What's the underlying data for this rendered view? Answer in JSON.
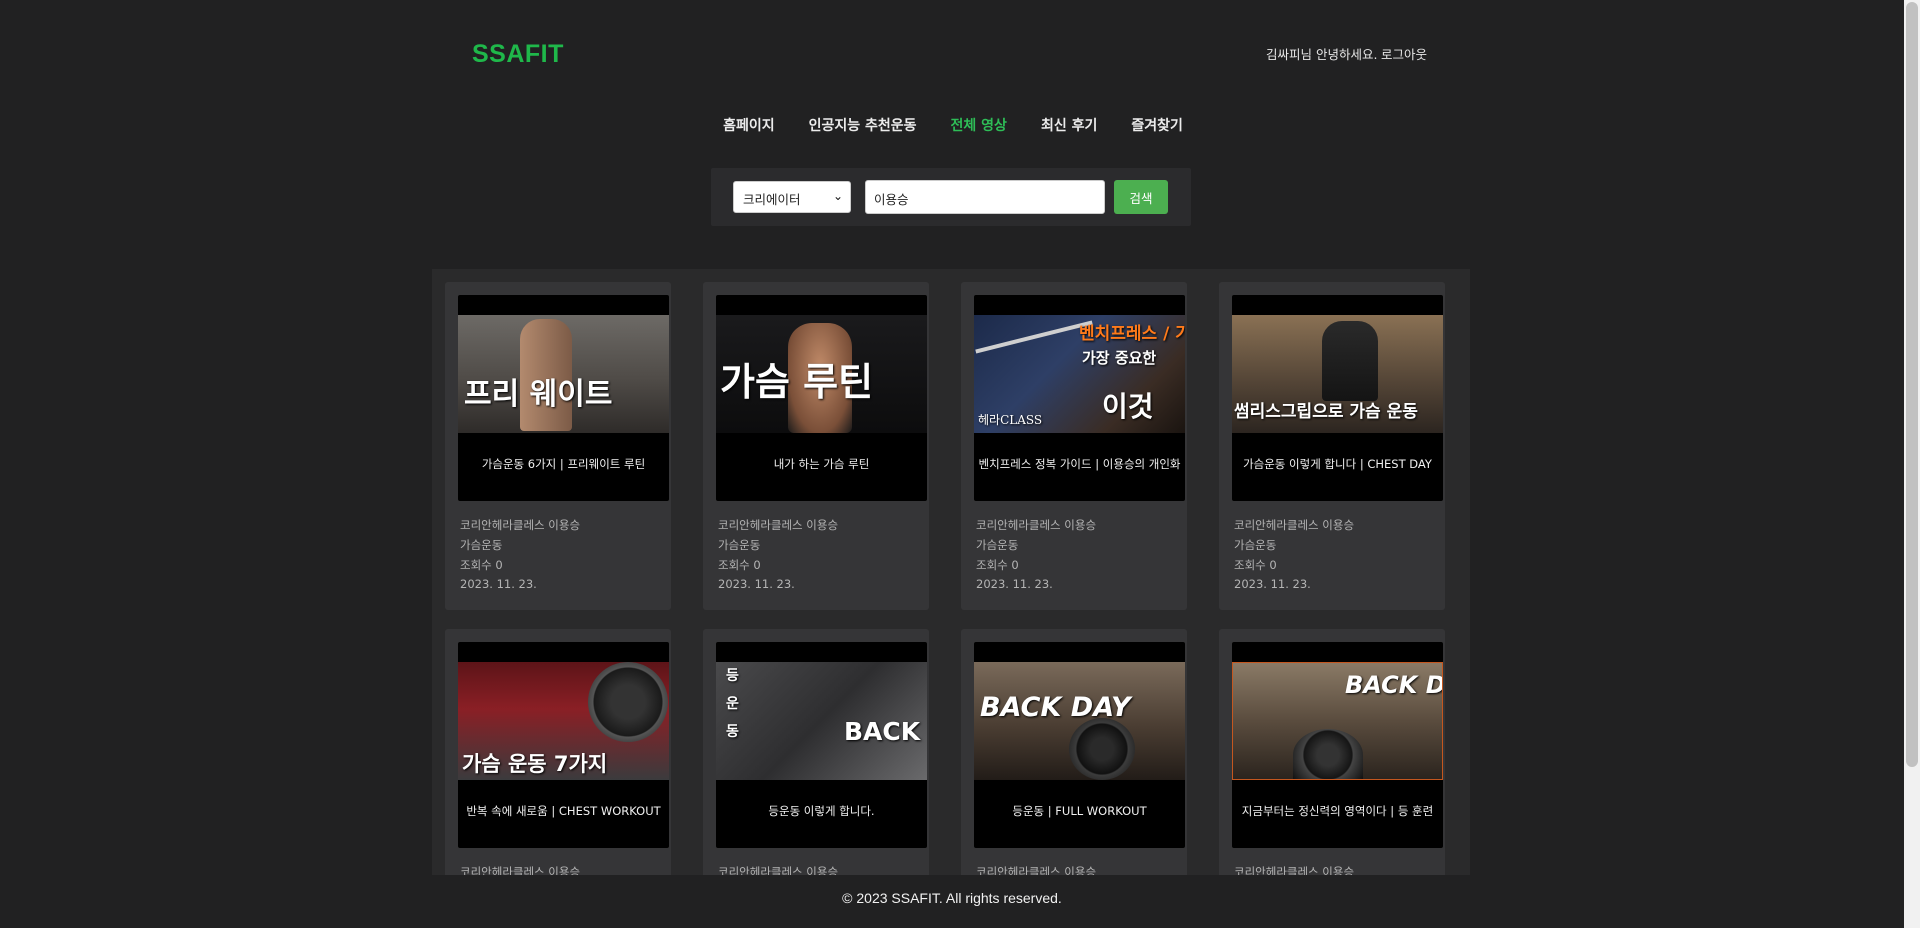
{
  "header": {
    "logo": "SSAFIT",
    "greeting": "김싸피님 안녕하세요.",
    "logout": "로그아웃"
  },
  "nav": [
    {
      "label": "홈페이지",
      "active": false
    },
    {
      "label": "인공지능 추천운동",
      "active": false
    },
    {
      "label": "전체 영상",
      "active": true
    },
    {
      "label": "최신 후기",
      "active": false
    },
    {
      "label": "즐겨찾기",
      "active": false
    }
  ],
  "search": {
    "filter_selected": "크리에이터",
    "query": "이용승",
    "button": "검색"
  },
  "videos": [
    {
      "overlay": "프리   웨이트",
      "title": "가슴운동 6가지 | 프리웨이트 루틴",
      "channel": "코리안헤라클레스 이용승",
      "category": "가슴운동",
      "views": "조회수 0",
      "date": "2023. 11. 23."
    },
    {
      "overlay": "가슴   루틴",
      "title": "내가 하는 가슴 루틴",
      "channel": "코리안헤라클레스 이용승",
      "category": "가슴운동",
      "views": "조회수 0",
      "date": "2023. 11. 23."
    },
    {
      "overlay": "벤치프레스 / 가장 중요한 / 이것",
      "title": "벤치프레스 정복 가이드 | 이용승의 개인화",
      "channel": "코리안헤라클레스 이용승",
      "category": "가슴운동",
      "views": "조회수 0",
      "date": "2023. 11. 23."
    },
    {
      "overlay": "썸리스그립으로 가슴 운동",
      "title": "가슴운동 이렇게 합니다 | CHEST DAY",
      "channel": "코리안헤라클레스 이용승",
      "category": "가슴운동",
      "views": "조회수 0",
      "date": "2023. 11. 23."
    },
    {
      "overlay": "가슴 운동 7가지",
      "title": "반복 속에 새로움 | CHEST WORKOUT",
      "channel": "코리안헤라클레스 이용승",
      "category": "",
      "views": "",
      "date": ""
    },
    {
      "overlay": "BACK DAY",
      "title": "등운동 이렇게 합니다.",
      "channel": "코리안헤라클레스 이용승",
      "category": "",
      "views": "",
      "date": ""
    },
    {
      "overlay": "BACK   DAY",
      "title": "등운동 | FULL WORKOUT",
      "channel": "코리안헤라클레스 이용승",
      "category": "",
      "views": "",
      "date": ""
    },
    {
      "overlay": "BACK DAY",
      "title": "지금부터는 정신력의 영역이다 | 등 훈련",
      "channel": "코리안헤라클레스 이용승",
      "category": "",
      "views": "",
      "date": ""
    }
  ],
  "footer": "© 2023 SSAFIT. All rights reserved.",
  "colors": {
    "accent": "#1fb84a",
    "button": "#4caf50",
    "bg": "#212122",
    "card": "#353537"
  }
}
